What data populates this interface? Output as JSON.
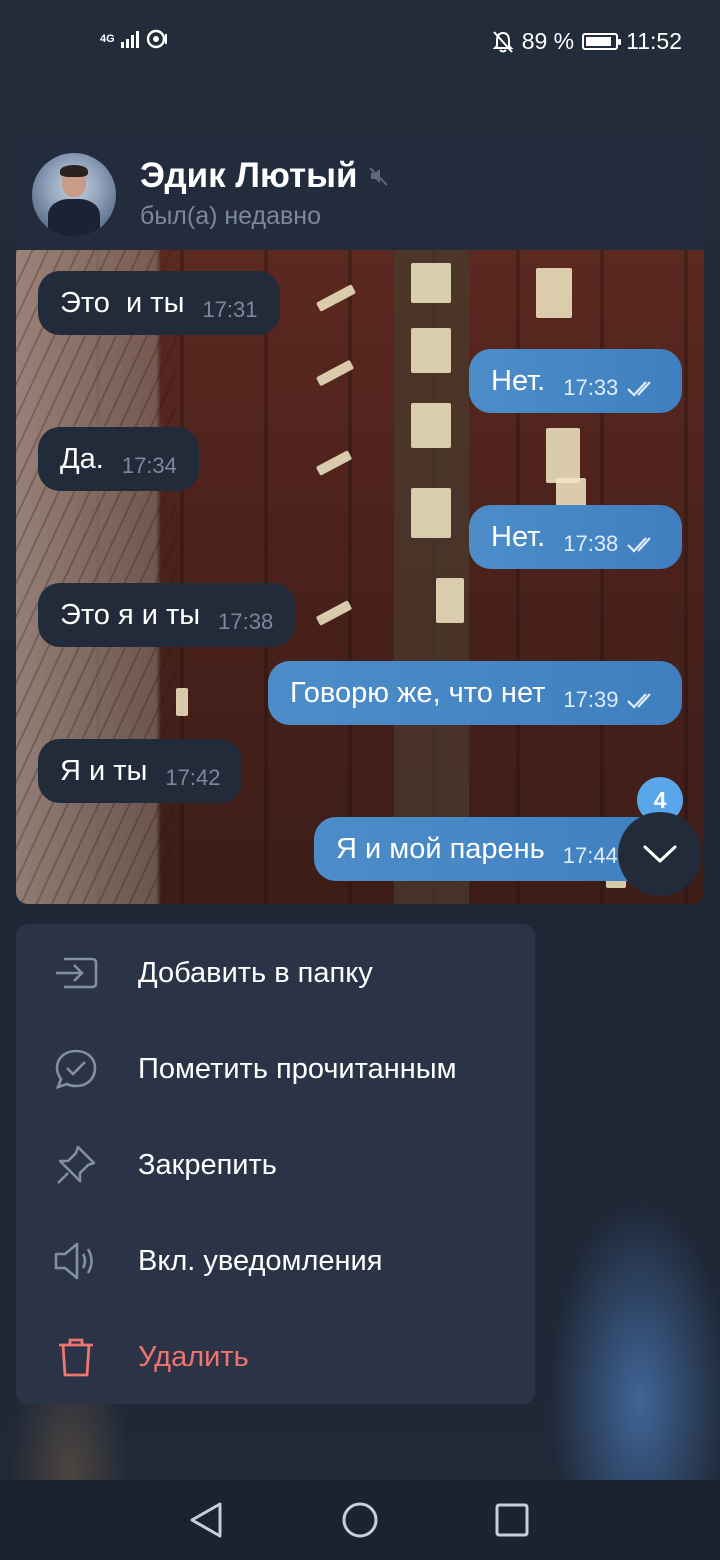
{
  "status_bar": {
    "network_label": "4G",
    "battery_text": "89 %",
    "battery_level": 0.89,
    "time": "11:52"
  },
  "chat": {
    "name": "Эдик Лютый",
    "status": "был(а) недавно",
    "muted": true,
    "messages": [
      {
        "side": "in",
        "text": "Это  и ты",
        "time": "17:31"
      },
      {
        "side": "out",
        "text": "Нет.",
        "time": "17:33",
        "read": true
      },
      {
        "side": "in",
        "text": "Да.",
        "time": "17:34"
      },
      {
        "side": "out",
        "text": "Нет.",
        "time": "17:38",
        "read": true
      },
      {
        "side": "in",
        "text": "Это я и ты",
        "time": "17:38"
      },
      {
        "side": "out",
        "text": "Говорю же, что нет",
        "time": "17:39",
        "read": true
      },
      {
        "side": "in",
        "text": "Я и ты",
        "time": "17:42"
      },
      {
        "side": "out",
        "text": "Я и мой парень",
        "time": "17:44",
        "read": true
      }
    ],
    "unread_count": "4"
  },
  "menu": {
    "items": [
      {
        "label": "Добавить в папку",
        "icon": "folder-add-icon"
      },
      {
        "label": "Пометить прочитанным",
        "icon": "mark-read-icon"
      },
      {
        "label": "Закрепить",
        "icon": "pin-icon"
      },
      {
        "label": "Вкл. уведомления",
        "icon": "speaker-icon"
      },
      {
        "label": "Удалить",
        "icon": "trash-icon",
        "danger": true
      }
    ]
  },
  "colors": {
    "accent_blue": "#4c8dc9",
    "danger_red": "#f07470",
    "menu_bg": "#2b3446",
    "incoming_bubble": "#222b3a"
  }
}
